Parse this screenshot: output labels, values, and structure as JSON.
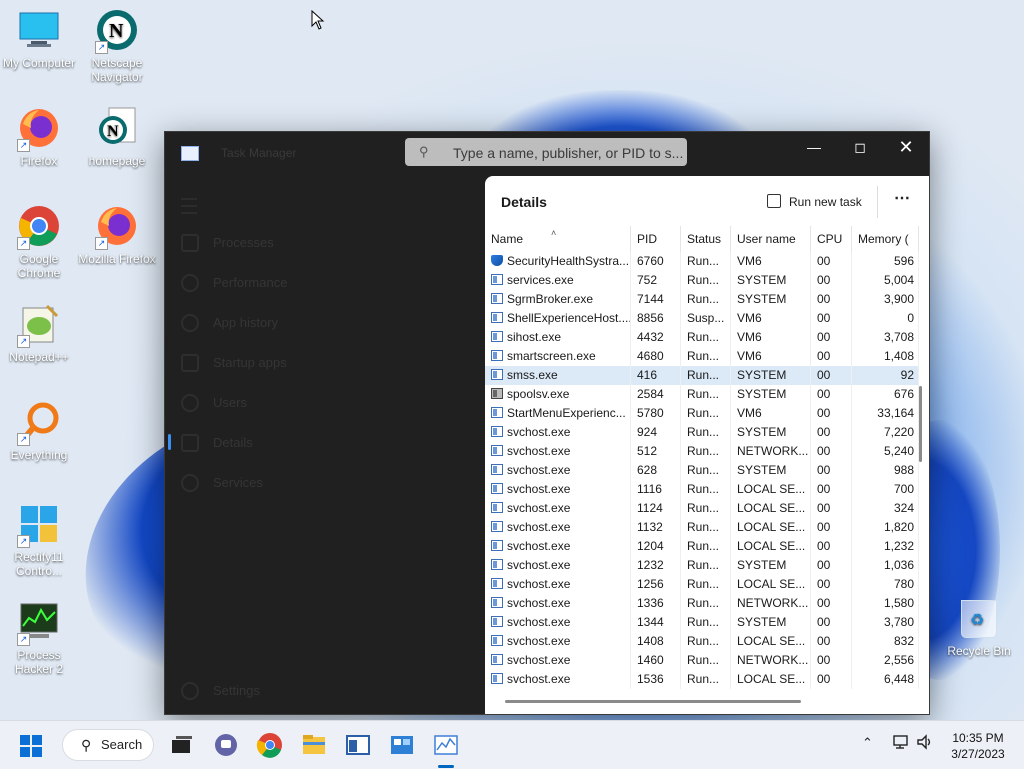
{
  "desktop": {
    "icons": [
      {
        "label": "My Computer"
      },
      {
        "label": "Netscape Navigator"
      },
      {
        "label": "Firefox"
      },
      {
        "label": "homepage"
      },
      {
        "label": "Google Chrome"
      },
      {
        "label": "Mozilla Firefox"
      },
      {
        "label": "Notepad++"
      },
      {
        "label": "Everything"
      },
      {
        "label": "Rectify11 Contro..."
      },
      {
        "label": "Process Hacker 2"
      }
    ],
    "recycle_bin": "Recycle Bin"
  },
  "task_manager": {
    "title": "Task Manager",
    "search_placeholder": "Type a name, publisher, or PID to s...",
    "nav": [
      {
        "label": "Processes"
      },
      {
        "label": "Performance"
      },
      {
        "label": "App history"
      },
      {
        "label": "Startup apps"
      },
      {
        "label": "Users"
      },
      {
        "label": "Details"
      },
      {
        "label": "Services"
      }
    ],
    "settings_label": "Settings",
    "panel_title": "Details",
    "run_new_task": "Run new task",
    "more": "⋯",
    "columns": [
      "Name",
      "PID",
      "Status",
      "User name",
      "CPU",
      "Memory ("
    ],
    "rows": [
      {
        "name": "SecurityHealthSystra...",
        "pid": "6760",
        "status": "Run...",
        "user": "VM6",
        "cpu": "00",
        "mem": "596"
      },
      {
        "name": "services.exe",
        "pid": "752",
        "status": "Run...",
        "user": "SYSTEM",
        "cpu": "00",
        "mem": "5,004"
      },
      {
        "name": "SgrmBroker.exe",
        "pid": "7144",
        "status": "Run...",
        "user": "SYSTEM",
        "cpu": "00",
        "mem": "3,900"
      },
      {
        "name": "ShellExperienceHost....",
        "pid": "8856",
        "status": "Susp...",
        "user": "VM6",
        "cpu": "00",
        "mem": "0"
      },
      {
        "name": "sihost.exe",
        "pid": "4432",
        "status": "Run...",
        "user": "VM6",
        "cpu": "00",
        "mem": "3,708"
      },
      {
        "name": "smartscreen.exe",
        "pid": "4680",
        "status": "Run...",
        "user": "VM6",
        "cpu": "00",
        "mem": "1,408"
      },
      {
        "name": "smss.exe",
        "pid": "416",
        "status": "Run...",
        "user": "SYSTEM",
        "cpu": "00",
        "mem": "92"
      },
      {
        "name": "spoolsv.exe",
        "pid": "2584",
        "status": "Run...",
        "user": "SYSTEM",
        "cpu": "00",
        "mem": "676"
      },
      {
        "name": "StartMenuExperienc...",
        "pid": "5780",
        "status": "Run...",
        "user": "VM6",
        "cpu": "00",
        "mem": "33,164"
      },
      {
        "name": "svchost.exe",
        "pid": "924",
        "status": "Run...",
        "user": "SYSTEM",
        "cpu": "00",
        "mem": "7,220"
      },
      {
        "name": "svchost.exe",
        "pid": "512",
        "status": "Run...",
        "user": "NETWORK...",
        "cpu": "00",
        "mem": "5,240"
      },
      {
        "name": "svchost.exe",
        "pid": "628",
        "status": "Run...",
        "user": "SYSTEM",
        "cpu": "00",
        "mem": "988"
      },
      {
        "name": "svchost.exe",
        "pid": "1116",
        "status": "Run...",
        "user": "LOCAL SE...",
        "cpu": "00",
        "mem": "700"
      },
      {
        "name": "svchost.exe",
        "pid": "1124",
        "status": "Run...",
        "user": "LOCAL SE...",
        "cpu": "00",
        "mem": "324"
      },
      {
        "name": "svchost.exe",
        "pid": "1132",
        "status": "Run...",
        "user": "LOCAL SE...",
        "cpu": "00",
        "mem": "1,820"
      },
      {
        "name": "svchost.exe",
        "pid": "1204",
        "status": "Run...",
        "user": "LOCAL SE...",
        "cpu": "00",
        "mem": "1,232"
      },
      {
        "name": "svchost.exe",
        "pid": "1232",
        "status": "Run...",
        "user": "SYSTEM",
        "cpu": "00",
        "mem": "1,036"
      },
      {
        "name": "svchost.exe",
        "pid": "1256",
        "status": "Run...",
        "user": "LOCAL SE...",
        "cpu": "00",
        "mem": "780"
      },
      {
        "name": "svchost.exe",
        "pid": "1336",
        "status": "Run...",
        "user": "NETWORK...",
        "cpu": "00",
        "mem": "1,580"
      },
      {
        "name": "svchost.exe",
        "pid": "1344",
        "status": "Run...",
        "user": "SYSTEM",
        "cpu": "00",
        "mem": "3,780"
      },
      {
        "name": "svchost.exe",
        "pid": "1408",
        "status": "Run...",
        "user": "LOCAL SE...",
        "cpu": "00",
        "mem": "832"
      },
      {
        "name": "svchost.exe",
        "pid": "1460",
        "status": "Run...",
        "user": "NETWORK...",
        "cpu": "00",
        "mem": "2,556"
      },
      {
        "name": "svchost.exe",
        "pid": "1536",
        "status": "Run...",
        "user": "LOCAL SE...",
        "cpu": "00",
        "mem": "6,448"
      }
    ],
    "selected_row": "smss.exe"
  },
  "taskbar": {
    "search_label": "Search",
    "time": "10:35 PM",
    "date": "3/27/2023"
  },
  "colors": {
    "accent": "#0067c0",
    "selection": "#dce9f7",
    "tm_background": "#202020"
  }
}
